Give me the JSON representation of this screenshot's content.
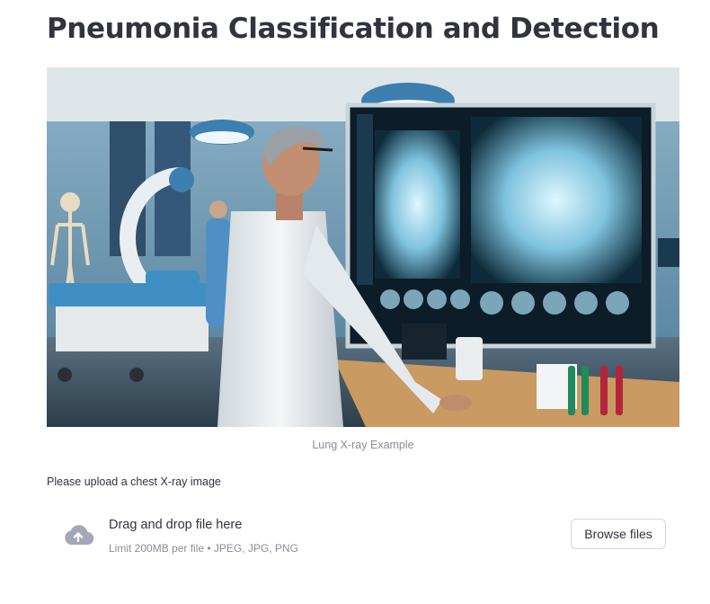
{
  "page": {
    "title": "Pneumonia Classification and Detection"
  },
  "hero_image": {
    "caption": "Lung X-ray Example"
  },
  "uploader": {
    "label": "Please upload a chest X-ray image",
    "drop_title": "Drag and drop file here",
    "limit_text": "Limit 200MB per file • JPEG, JPG, PNG",
    "browse_label": "Browse files",
    "icon": "cloud-upload-icon"
  },
  "colors": {
    "text": "#31333f",
    "muted": "#8b8d97",
    "icon": "#a3a8b8",
    "border": "#d5d6db"
  }
}
